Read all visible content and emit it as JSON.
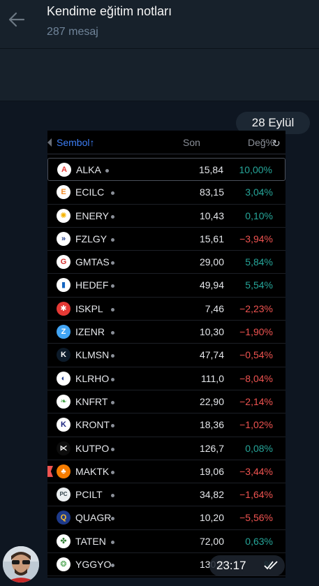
{
  "header": {
    "title": "Kendime eğitim notları",
    "subtitle": "287 mesaj"
  },
  "message": {
    "date_label": "28 Eylül",
    "time": "23:17"
  },
  "table": {
    "headers": {
      "symbol": "Sembol",
      "sort_arrow": "↑",
      "last": "Son",
      "change": "Değ%"
    },
    "rows": [
      {
        "symbol": "ALKA",
        "last": "15,84",
        "change": "10,00%",
        "dir": "pos",
        "icon_bg": "#ffffff",
        "icon_fg": "#e53935",
        "icon_glyph": "A"
      },
      {
        "symbol": "ECILC",
        "last": "83,15",
        "change": "3,04%",
        "dir": "pos",
        "icon_bg": "#ffffff",
        "icon_fg": "#f28c28",
        "icon_glyph": "E"
      },
      {
        "symbol": "ENERY",
        "last": "10,43",
        "change": "0,10%",
        "dir": "pos",
        "icon_bg": "#ffffff",
        "icon_fg": "#f5b300",
        "icon_glyph": "✺"
      },
      {
        "symbol": "FZLGY",
        "last": "15,61",
        "change": "−3,94%",
        "dir": "neg",
        "icon_bg": "#ffffff",
        "icon_fg": "#1e3a8a",
        "icon_glyph": "»"
      },
      {
        "symbol": "GMTAS",
        "last": "29,00",
        "change": "5,84%",
        "dir": "pos",
        "icon_bg": "#ffffff",
        "icon_fg": "#d32f2f",
        "icon_glyph": "G"
      },
      {
        "symbol": "HEDEF",
        "last": "49,94",
        "change": "5,54%",
        "dir": "pos",
        "icon_bg": "#ffffff",
        "icon_fg": "#1565c0",
        "icon_glyph": "▮"
      },
      {
        "symbol": "ISKPL",
        "last": "7,46",
        "change": "−2,23%",
        "dir": "neg",
        "icon_bg": "#e53935",
        "icon_fg": "#ffffff",
        "icon_glyph": "✱"
      },
      {
        "symbol": "IZENR",
        "last": "10,30",
        "change": "−1,90%",
        "dir": "neg",
        "icon_bg": "#42a5f5",
        "icon_fg": "#ffffff",
        "icon_glyph": "Z"
      },
      {
        "symbol": "KLMSN",
        "last": "47,74",
        "change": "−0,54%",
        "dir": "neg",
        "icon_bg": "#0d1b2a",
        "icon_fg": "#ffffff",
        "icon_glyph": "K"
      },
      {
        "symbol": "KLRHO",
        "last": "111,0",
        "change": "−8,04%",
        "dir": "neg",
        "icon_bg": "#ffffff",
        "icon_fg": "#1e3a8a",
        "icon_glyph": "◐"
      },
      {
        "symbol": "KNFRT",
        "last": "22,90",
        "change": "−2,14%",
        "dir": "neg",
        "icon_bg": "#ffffff",
        "icon_fg": "#43a047",
        "icon_glyph": "❧"
      },
      {
        "symbol": "KRONT",
        "last": "18,36",
        "change": "−1,02%",
        "dir": "neg",
        "icon_bg": "#ffffff",
        "icon_fg": "#1a237e",
        "icon_glyph": "K"
      },
      {
        "symbol": "KUTPO",
        "last": "126,7",
        "change": "0,08%",
        "dir": "pos",
        "icon_bg": "#0d0d0d",
        "icon_fg": "#ffffff",
        "icon_glyph": "⋉"
      },
      {
        "symbol": "MAKTK",
        "last": "19,06",
        "change": "−3,44%",
        "dir": "neg",
        "icon_bg": "#f57c00",
        "icon_fg": "#ffffff",
        "icon_glyph": "♣"
      },
      {
        "symbol": "PCILT",
        "last": "34,82",
        "change": "−1,64%",
        "dir": "neg",
        "icon_bg": "#eceff1",
        "icon_fg": "#37474f",
        "icon_glyph": "PC"
      },
      {
        "symbol": "QUAGR",
        "last": "10,20",
        "change": "−5,56%",
        "dir": "neg",
        "icon_bg": "#1e3a8a",
        "icon_fg": "#fbc02d",
        "icon_glyph": "Q"
      },
      {
        "symbol": "TATEN",
        "last": "72,00",
        "change": "0,63%",
        "dir": "pos",
        "icon_bg": "#ffffff",
        "icon_fg": "#2e7d32",
        "icon_glyph": "✤"
      },
      {
        "symbol": "YGGYO",
        "last": "130,0",
        "change": "%",
        "dir": "pos",
        "icon_bg": "#ffffff",
        "icon_fg": "#43a047",
        "icon_glyph": "❂"
      }
    ]
  }
}
